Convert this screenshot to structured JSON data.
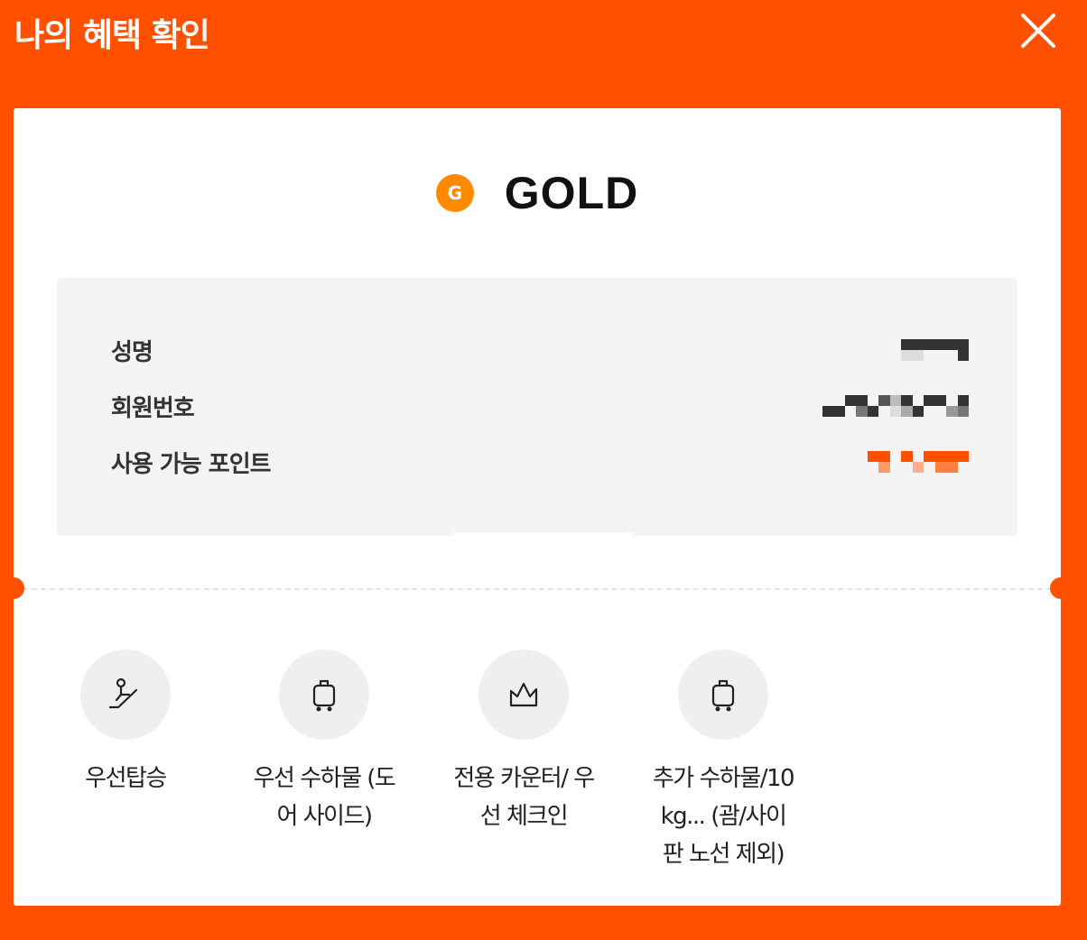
{
  "header": {
    "title": "나의 혜택 확인",
    "close_icon": "close-icon"
  },
  "membership": {
    "badge_letter": "G",
    "grade": "GOLD",
    "badge_color": "#ff8a00"
  },
  "info": {
    "name_label": "성명",
    "member_no_label": "회원번호",
    "points_label": "사용 가능 포인트"
  },
  "benefits": [
    {
      "icon": "priority-boarding-icon",
      "label": "우선탑승"
    },
    {
      "icon": "luggage-icon",
      "label": "우선 수하물 (도어 사이드)"
    },
    {
      "icon": "crown-icon",
      "label": "전용 카운터/ 우선 체크인"
    },
    {
      "icon": "luggage-icon",
      "label": "추가 수하물/10kg... (괌/사이판 노선 제외)"
    }
  ],
  "colors": {
    "accent": "#ff5000",
    "card": "#ffffff",
    "info_bg": "#f4f4f4"
  }
}
